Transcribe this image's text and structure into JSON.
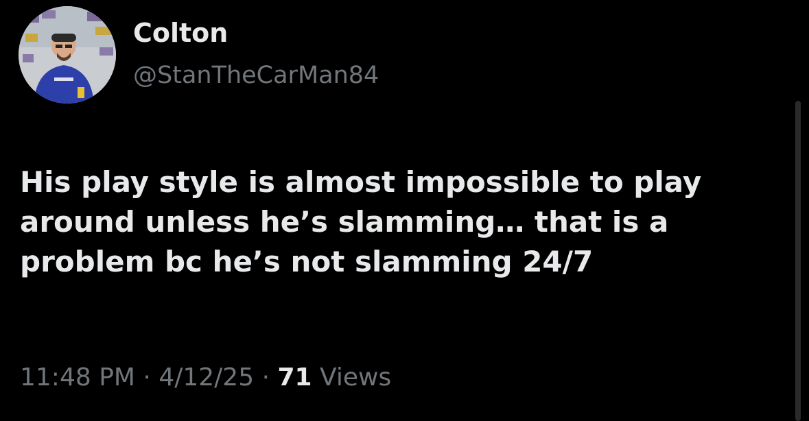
{
  "author": {
    "display_name": "Colton",
    "handle": "@StanTheCarMan84"
  },
  "tweet": {
    "lines": [
      "His play style is almost impossible to play",
      "around unless he’s slamming… that is a",
      "problem bc he’s not slamming 24/7"
    ]
  },
  "meta": {
    "time": "11:48 PM",
    "separator": "·",
    "date": "4/12/25",
    "views_count": "71",
    "views_label": "Views"
  },
  "colors": {
    "background": "#000000",
    "primary_text": "#e7e9ea",
    "secondary_text": "#71767b"
  }
}
